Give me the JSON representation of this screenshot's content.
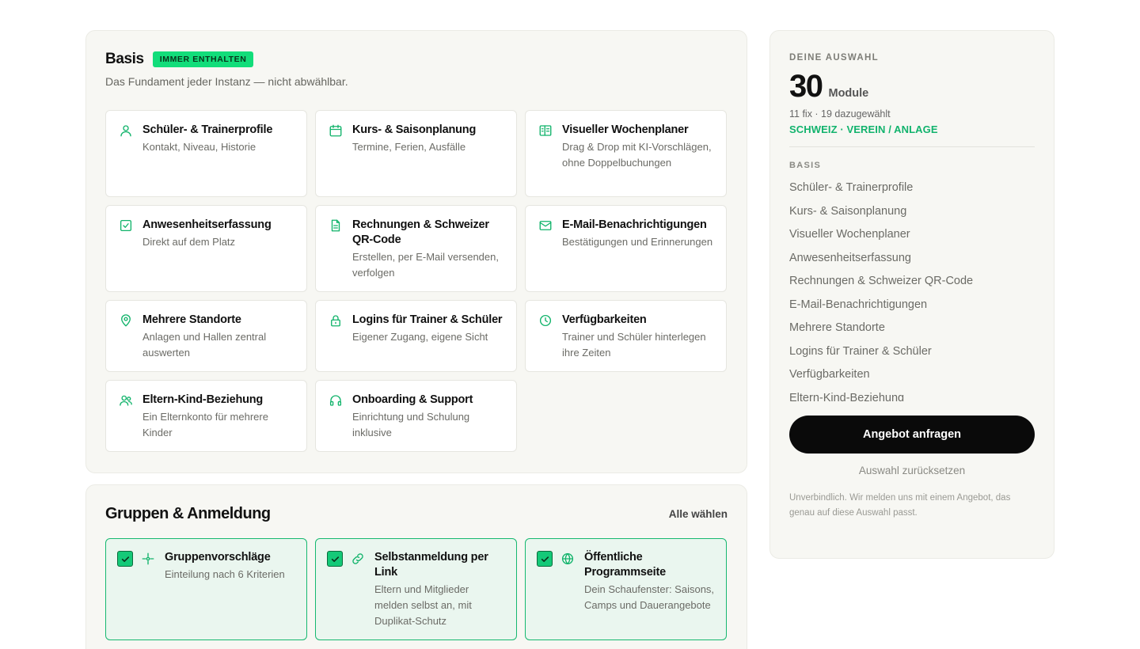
{
  "basis": {
    "title": "Basis",
    "badge": "IMMER ENTHALTEN",
    "subtitle": "Das Fundament jeder Instanz — nicht abwählbar.",
    "modules": [
      {
        "icon": "user-icon",
        "title": "Schüler- & Trainerprofile",
        "desc": "Kontakt, Niveau, Historie"
      },
      {
        "icon": "calendar-icon",
        "title": "Kurs- & Saisonplanung",
        "desc": "Termine, Ferien, Ausfälle"
      },
      {
        "icon": "week-planner-icon",
        "title": "Visueller Wochenplaner",
        "desc": "Drag & Drop mit KI-Vorschlägen, ohne Doppelbuchungen"
      },
      {
        "icon": "checkbox-icon",
        "title": "Anwesenheitserfassung",
        "desc": "Direkt auf dem Platz"
      },
      {
        "icon": "document-icon",
        "title": "Rechnungen & Schweizer QR-Code",
        "desc": "Erstellen, per E-Mail versenden, verfolgen"
      },
      {
        "icon": "mail-icon",
        "title": "E-Mail-Benachrichtigungen",
        "desc": "Bestätigungen und Erinnerungen"
      },
      {
        "icon": "map-pin-icon",
        "title": "Mehrere Standorte",
        "desc": "Anlagen und Hallen zentral auswerten"
      },
      {
        "icon": "lock-icon",
        "title": "Logins für Trainer & Schüler",
        "desc": "Eigener Zugang, eigene Sicht"
      },
      {
        "icon": "clock-icon",
        "title": "Verfügbarkeiten",
        "desc": "Trainer und Schüler hinterlegen ihre Zeiten"
      },
      {
        "icon": "users-icon",
        "title": "Eltern-Kind-Beziehung",
        "desc": "Ein Elternkonto für mehrere Kinder"
      },
      {
        "icon": "headset-icon",
        "title": "Onboarding & Support",
        "desc": "Einrichtung und Schulung inklusive"
      }
    ]
  },
  "groups": {
    "title": "Gruppen & Anmeldung",
    "select_all": "Alle wählen",
    "modules": [
      {
        "icon": "sparkle-icon",
        "title": "Gruppenvorschläge",
        "desc": "Einteilung nach 6 Kriterien",
        "checked": true
      },
      {
        "icon": "link-icon",
        "title": "Selbstanmeldung per Link",
        "desc": "Eltern und Mitglieder melden selbst an, mit Duplikat-Schutz",
        "checked": true
      },
      {
        "icon": "globe-icon",
        "title": "Öffentliche Programmseite",
        "desc": "Dein Schaufenster: Saisons, Camps und Dauerangebote",
        "checked": true
      }
    ]
  },
  "summary": {
    "eyebrow": "DEINE AUSWAHL",
    "count": "30",
    "count_unit": "Module",
    "count_detail": "11 fix · 19 dazugewählt",
    "region": "SCHWEIZ · VEREIN / ANLAGE",
    "list_label": "BASIS",
    "items": [
      "Schüler- & Trainerprofile",
      "Kurs- & Saisonplanung",
      "Visueller Wochenplaner",
      "Anwesenheitserfassung",
      "Rechnungen & Schweizer QR-Code",
      "E-Mail-Benachrichtigungen",
      "Mehrere Standorte",
      "Logins für Trainer & Schüler",
      "Verfügbarkeiten",
      "Eltern-Kind-Beziehung"
    ],
    "cta": "Angebot anfragen",
    "reset": "Auswahl zurücksetzen",
    "note": "Unverbindlich. Wir melden uns mit einem Angebot, das genau auf diese Auswahl passt."
  },
  "colors": {
    "accent": "#12b36d",
    "badge": "#12dd7a",
    "selected_bg": "#eaf6ef",
    "cta_bg": "#0a0a0a"
  }
}
